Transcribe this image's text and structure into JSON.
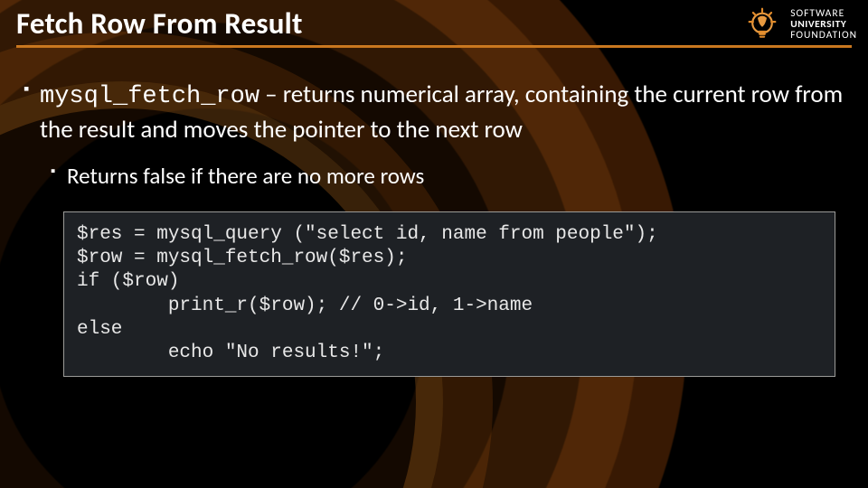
{
  "title": "Fetch Row From Result",
  "logo": {
    "line1": "SOFTWARE",
    "line2": "UNIVERSITY",
    "line3": "FOUNDATION"
  },
  "bullet1": {
    "code": "mysql_fetch_row",
    "rest": " – returns numerical array, containing the current row from the result and moves the pointer to the next row"
  },
  "bullet2": {
    "text": "Returns false if there are no more rows"
  },
  "code_block": "$res = mysql_query (\"select id, name from people\");\n$row = mysql_fetch_row($res);\nif ($row)\n        print_r($row); // 0->id, 1->name\nelse\n        echo \"No results!\";"
}
